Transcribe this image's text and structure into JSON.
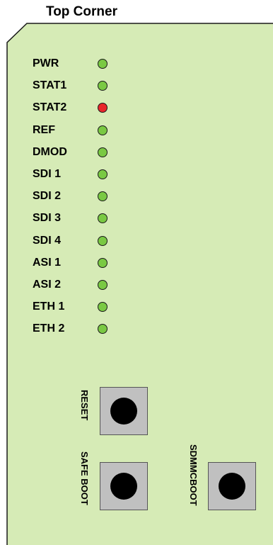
{
  "title": "Top Corner",
  "colors": {
    "board_fill": "#d6ebb6",
    "board_stroke": "#1a1a1a",
    "led_green": "#7ac943",
    "led_red": "#e8262b",
    "button_fill": "#c0c0c0",
    "button_knob": "#000000"
  },
  "leds": [
    {
      "label": "PWR",
      "state": "green"
    },
    {
      "label": "STAT1",
      "state": "green"
    },
    {
      "label": "STAT2",
      "state": "red"
    },
    {
      "label": "REF",
      "state": "green"
    },
    {
      "label": "DMOD",
      "state": "green"
    },
    {
      "label": "SDI 1",
      "state": "green"
    },
    {
      "label": "SDI 2",
      "state": "green"
    },
    {
      "label": "SDI 3",
      "state": "green"
    },
    {
      "label": "SDI 4",
      "state": "green"
    },
    {
      "label": "ASI 1",
      "state": "green"
    },
    {
      "label": "ASI 2",
      "state": "green"
    },
    {
      "label": "ETH 1",
      "state": "green"
    },
    {
      "label": "ETH 2",
      "state": "green"
    }
  ],
  "buttons": {
    "reset": {
      "label": "RESET"
    },
    "safe_boot": {
      "label": "SAFE BOOT"
    },
    "sdmmc_boot": {
      "label": "SDMMCBOOT"
    }
  }
}
